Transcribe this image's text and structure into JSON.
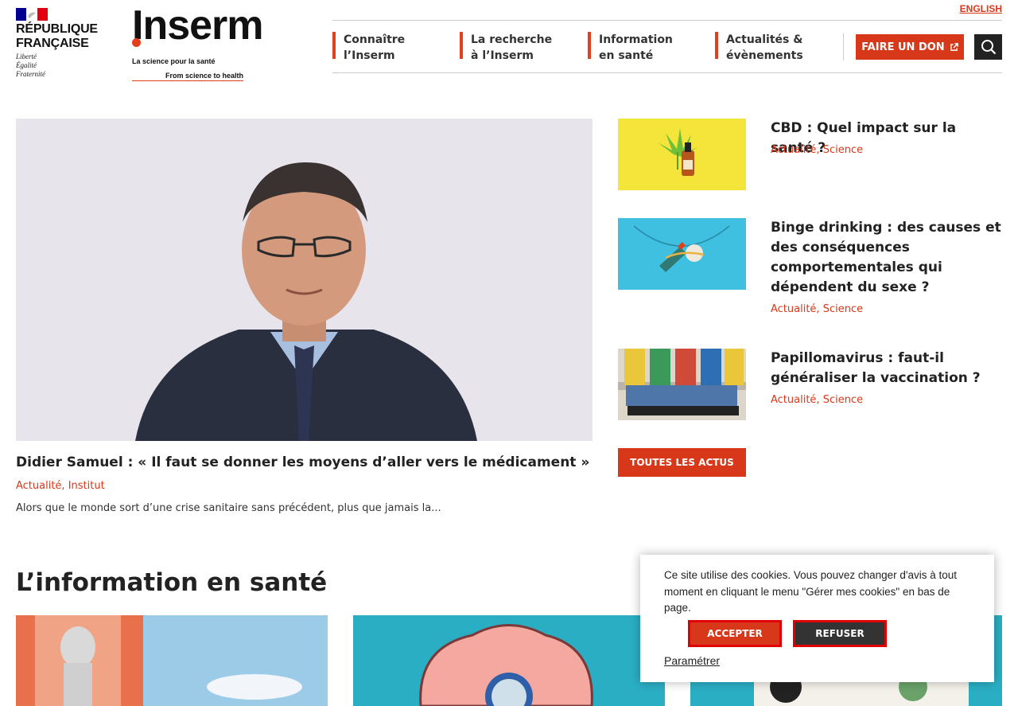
{
  "header": {
    "republique": {
      "line1": "RÉPUBLIQUE",
      "line2": "FRANÇAISE",
      "motto1": "Liberté",
      "motto2": "Égalité",
      "motto3": "Fraternité"
    },
    "inserm": {
      "name": "Inserm",
      "tagline_fr": "La science pour la santé",
      "tagline_en": "From science to health"
    },
    "language_link": "ENGLISH",
    "nav": [
      {
        "label": "Connaître\nl’Inserm"
      },
      {
        "label": "La recherche\nà l’Inserm"
      },
      {
        "label": "Information\nen santé"
      },
      {
        "label": "Actualités &\névènements"
      }
    ],
    "donate_label": "FAIRE UN DON",
    "icons": {
      "external": "external-link-icon",
      "search": "search-icon"
    }
  },
  "featured": {
    "title": "Didier Samuel : « Il faut se donner les moyens d’aller vers le médicament »",
    "categories": "Actualité, Institut",
    "excerpt": "Alors que le monde sort d’une crise sanitaire sans précédent, plus que jamais la..."
  },
  "news": [
    {
      "title": "CBD : Quel impact sur la santé ?",
      "categories": "Actualité, Science"
    },
    {
      "title": "Binge drinking : des causes et des conséquences comportementales qui dépendent du sexe ?",
      "categories": "Actualité, Science"
    },
    {
      "title": "Papillomavirus : faut-il généraliser la vaccination ?",
      "categories": "Actualité, Science"
    }
  ],
  "all_news_label": "TOUTES LES ACTUS",
  "section": {
    "title": "L’information en santé"
  },
  "cookie": {
    "text": "Ce site utilise des cookies. Vous pouvez changer d'avis à tout moment en cliquant le menu \"Gérer mes cookies\" en bas de page.",
    "accept": "ACCEPTER",
    "refuse": "REFUSER",
    "settings": "Paramétrer"
  },
  "colors": {
    "accent": "#d8381a",
    "flag_blue": "#000091",
    "flag_red": "#e1000f"
  }
}
